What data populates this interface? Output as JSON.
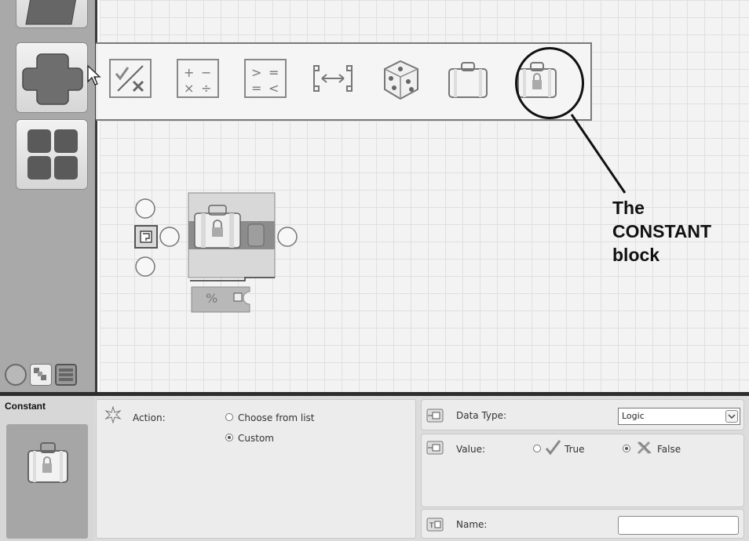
{
  "palette": {
    "tabs": [
      "common-palette",
      "complete-palette",
      "custom-palette"
    ]
  },
  "subpalette": {
    "items": [
      {
        "icon": "logic-icon"
      },
      {
        "icon": "math-icon"
      },
      {
        "icon": "compare-icon"
      },
      {
        "icon": "range-icon"
      },
      {
        "icon": "random-icon"
      },
      {
        "icon": "variable-icon"
      },
      {
        "icon": "constant-icon"
      }
    ]
  },
  "annotation": {
    "line1": "The",
    "line2": "CONSTANT",
    "line3": "block"
  },
  "config": {
    "title": "Constant",
    "action_label": "Action:",
    "action_options": [
      "Choose from list",
      "Custom"
    ],
    "action_selected": "Custom",
    "datatype_label": "Data Type:",
    "datatype_value": "Logic",
    "value_label": "Value:",
    "value_true": "True",
    "value_false": "False",
    "value_selected": "False",
    "name_label": "Name:",
    "name_value": ""
  },
  "colors": {
    "canvas_bg": "#f3f3f3",
    "grid_line": "#e0e0e0",
    "palette_bg": "#a9a9a9",
    "panel_bg": "#dcdcdc"
  }
}
